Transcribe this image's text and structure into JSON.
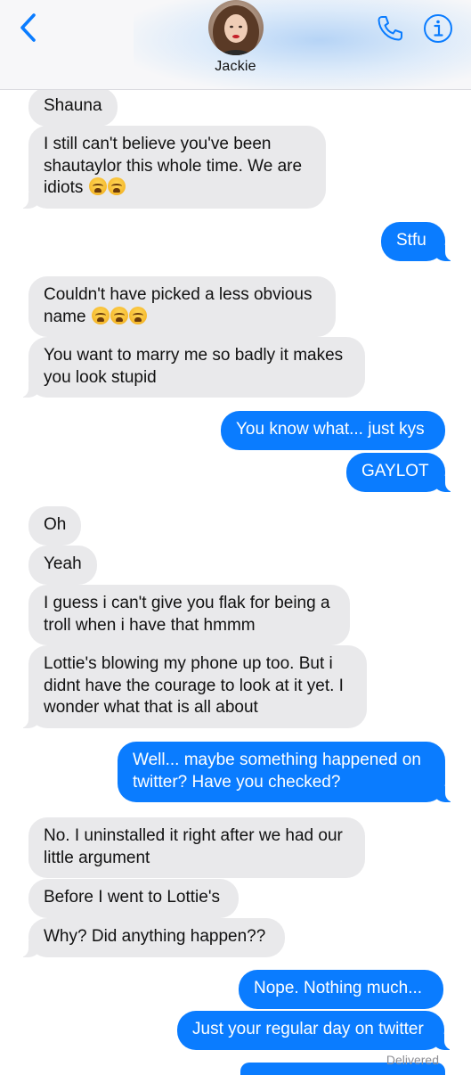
{
  "header": {
    "contact_name": "Jackie",
    "back_icon": "chevron-left-icon",
    "phone_icon": "phone-icon",
    "info_icon": "info-icon",
    "accent_color": "#0a7cff"
  },
  "messages": [
    {
      "side": "in",
      "text": "Shauna"
    },
    {
      "side": "in",
      "text": "I still can't believe you've been shautaylor this whole time. We are idiots",
      "emoji": "loudly-crying-face x2"
    },
    {
      "side": "out",
      "text": "Stfu"
    },
    {
      "side": "in",
      "text": "Couldn't have picked a less obvious name",
      "emoji": "loudly-crying-face x3"
    },
    {
      "side": "in",
      "text": "You want to marry me so badly it makes you look stupid"
    },
    {
      "side": "out",
      "text": "You know what... just kys"
    },
    {
      "side": "out",
      "text": "GAYLOT"
    },
    {
      "side": "in",
      "text": "Oh"
    },
    {
      "side": "in",
      "text": "Yeah"
    },
    {
      "side": "in",
      "text": "I guess i can't give you flak for being a troll when i have that hmmm"
    },
    {
      "side": "in",
      "text": "Lottie's blowing my phone up too. But i didnt have the courage to look at it yet. I wonder what that is all about"
    },
    {
      "side": "out",
      "text": "Well... maybe something happened on twitter? Have you checked?"
    },
    {
      "side": "in",
      "text": "No. I uninstalled it right after we had our little argument"
    },
    {
      "side": "in",
      "text": "Before I went to Lottie's"
    },
    {
      "side": "in",
      "text": "Why? Did anything happen??"
    },
    {
      "side": "out",
      "text": "Nope. Nothing much..."
    },
    {
      "side": "out",
      "text": "Just your regular day on twitter"
    }
  ],
  "status": {
    "delivered": "Delivered"
  },
  "colors": {
    "incoming_bubble": "#e9e9eb",
    "outgoing_bubble": "#0a7cff",
    "status_text": "#8e8e93"
  }
}
